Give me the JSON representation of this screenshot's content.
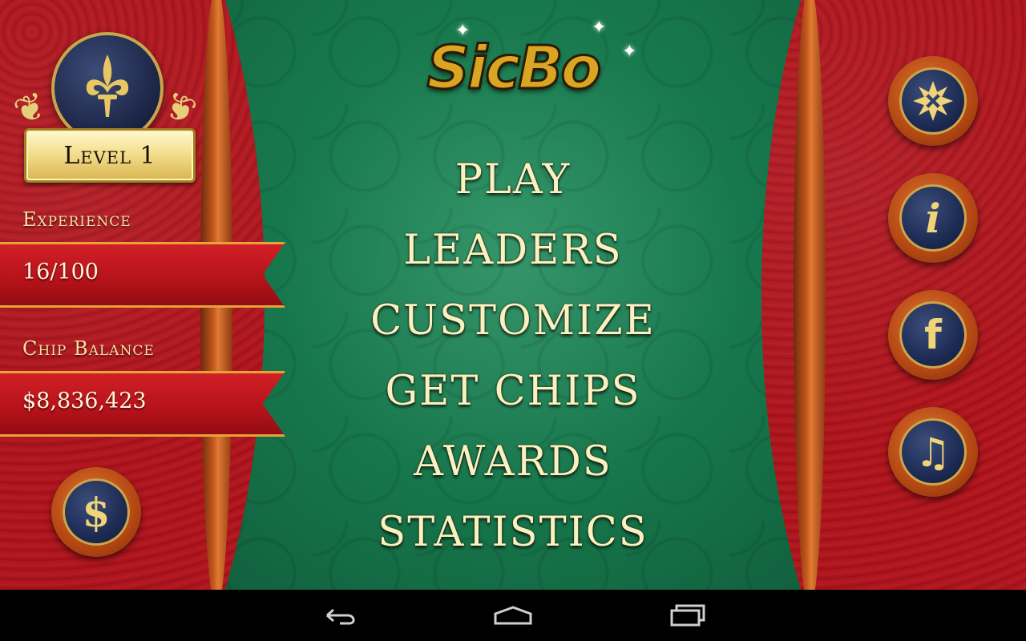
{
  "logo": {
    "text": "SicBo",
    "color": "#d9a523"
  },
  "level": {
    "label": "Level 1"
  },
  "experience": {
    "label": "Experience",
    "value": "16/100"
  },
  "chip_balance": {
    "label": "Chip Balance",
    "value": "$8,836,423"
  },
  "menu": {
    "items": [
      {
        "label": "PLAY"
      },
      {
        "label": "LEADERS"
      },
      {
        "label": "CUSTOMIZE"
      },
      {
        "label": "GET CHIPS"
      },
      {
        "label": "AWARDS"
      },
      {
        "label": "STATISTICS"
      }
    ]
  },
  "buttons": {
    "buy_chips_icon": "dollar-icon",
    "buy_chips_glyph": "$",
    "settings_icon": "snowflake-gear-icon",
    "info_icon": "info-icon",
    "info_glyph": "i",
    "facebook_icon": "facebook-icon",
    "facebook_glyph": "f",
    "music_icon": "music-note-icon",
    "music_glyph": "♫"
  },
  "navbar": {
    "back_icon": "back-icon",
    "home_icon": "home-icon",
    "recent_icon": "recent-apps-icon"
  },
  "colors": {
    "felt": "#16744a",
    "panel_red": "#a5131b",
    "rail": "#c2571d",
    "gold_text": "#fbf0bf"
  }
}
